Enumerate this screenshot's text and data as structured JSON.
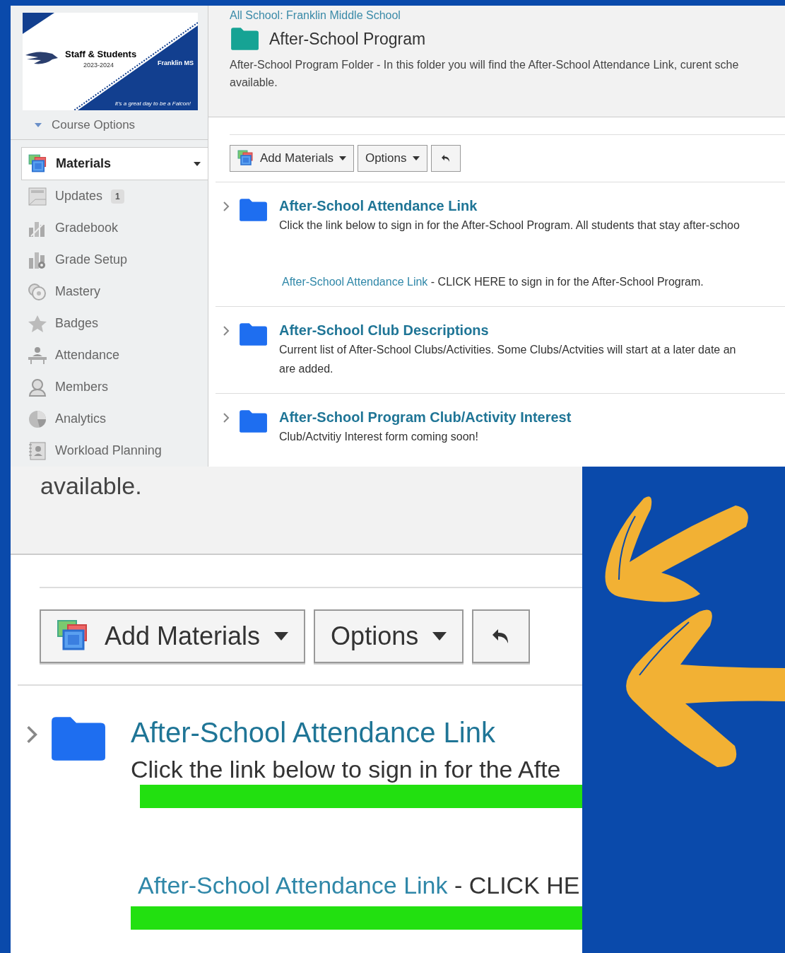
{
  "course": {
    "banner": {
      "title": "Staff & Students",
      "years": "2023-2024",
      "school": "Franklin MS",
      "tagline": "It's a great day to be a Falcon!"
    },
    "course_options": "Course Options"
  },
  "sidebar": {
    "items": [
      {
        "label": "Materials",
        "kind": "materials",
        "selected": true
      },
      {
        "label": "Updates",
        "kind": "updates",
        "badge": "1",
        "selected": false
      },
      {
        "label": "Gradebook",
        "kind": "gradebook",
        "selected": false
      },
      {
        "label": "Grade Setup",
        "kind": "grade-setup",
        "selected": false
      },
      {
        "label": "Mastery",
        "kind": "mastery",
        "selected": false
      },
      {
        "label": "Badges",
        "kind": "badges",
        "selected": false
      },
      {
        "label": "Attendance",
        "kind": "attendance",
        "selected": false
      },
      {
        "label": "Members",
        "kind": "members",
        "selected": false
      },
      {
        "label": "Analytics",
        "kind": "analytics",
        "selected": false
      },
      {
        "label": "Workload Planning",
        "kind": "workload",
        "selected": false
      }
    ]
  },
  "breadcrumb": "All School: Franklin Middle School",
  "folder": {
    "title": "After-School Program",
    "description_lines": [
      "After-School Program Folder - In this folder you will find the After-School Attendance Link, curent sche",
      "available."
    ]
  },
  "toolbar": {
    "add_materials": "Add Materials",
    "options": "Options"
  },
  "materials": [
    {
      "title": "After-School Attendance Link",
      "lines": [
        "Click the link below to sign in for the After-School Program. All students that stay after-schoo"
      ],
      "link": "After-School Attendance Link",
      "link_rest": " - CLICK HERE to sign in for the After-School Program."
    },
    {
      "title": "After-School Club Descriptions",
      "lines": [
        "Current list of After-School Clubs/Activities. Some Clubs/Actvities will start at a later date an",
        "are added."
      ]
    },
    {
      "title": "After-School Program Club/Activity Interest",
      "lines": [
        "Club/Actvitiy Interest form coming soon!"
      ]
    }
  ],
  "zoom_inset": {
    "description_tail": "available.",
    "add_materials": "Add Materials",
    "options": "Options",
    "item": {
      "title": "After-School Attendance Link",
      "text": "Click the link below to sign in for the Afte",
      "link": "After-School Attendance Link",
      "link_rest": " - CLICK HE"
    }
  }
}
